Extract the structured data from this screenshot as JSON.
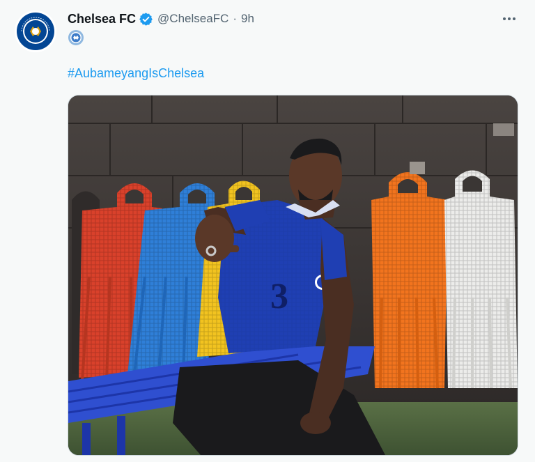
{
  "author": {
    "display_name": "Chelsea FC",
    "handle": "@ChelseaFC",
    "separator": "·",
    "time": "9h",
    "verified": true,
    "avatar_icon": "chelsea-crest-icon"
  },
  "tweet": {
    "emoji_icon": "chelsea-emoji-icon",
    "hashtag": "#AubameyangIsChelsea",
    "more_icon": "more-dots-icon"
  },
  "colors": {
    "link": "#1d9bf0",
    "verified": "#1d9bf0",
    "chelsea_blue": "#034694",
    "background": "#f7f9f9"
  }
}
